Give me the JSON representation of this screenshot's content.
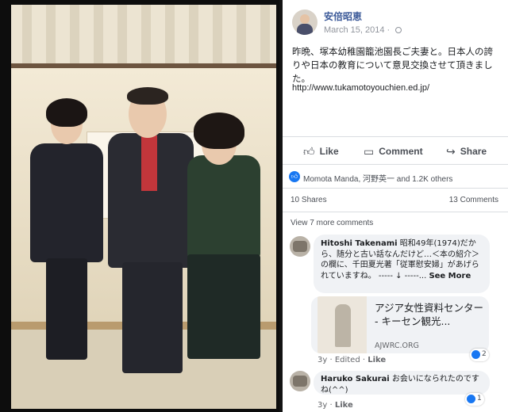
{
  "post": {
    "author": "安倍昭恵",
    "date": "March 15, 2014 · ",
    "text": "昨晩、塚本幼稚園籠池園長ご夫妻と。日本人の誇りや日本の教育について意見交換させて頂きました。",
    "link": "http://www.tukamotoyouchien.ed.jp/"
  },
  "actions": {
    "like": "Like",
    "comment": "Comment",
    "share": "Share"
  },
  "reactions": {
    "text": "Momota Manda, 河野英一 and 1.2K others"
  },
  "counts": {
    "shares": "10 Shares",
    "comments": "13 Comments"
  },
  "view_more": "View 7 more comments",
  "comments": [
    {
      "name": "Hitoshi Takenami",
      "text": "昭和49年(1974)だから、随分と古い話なんだけど…＜本の紹介＞の欄に、千田夏光著「従軍慰安婦」があげられていますね。",
      "tail": "----- ↓ -----... ",
      "see_more": "See More",
      "meta": "3y · Edited · ",
      "like": "Like",
      "likes": "2",
      "preview": {
        "title": "アジア女性資料センター - キーセン観光...",
        "domain": "AJWRC.ORG"
      }
    },
    {
      "name": "Haruko Sakurai",
      "text": "お会いになられたのですね(^^)",
      "meta": "3y · ",
      "like": "Like",
      "likes": "1"
    }
  ],
  "icons": [
    "thumbs-up-icon",
    "comment-icon",
    "share-icon",
    "globe-icon"
  ],
  "colors": {
    "link_blue": "#3b5998",
    "like_blue": "#1877f2",
    "bubble": "#f0f2f5"
  }
}
